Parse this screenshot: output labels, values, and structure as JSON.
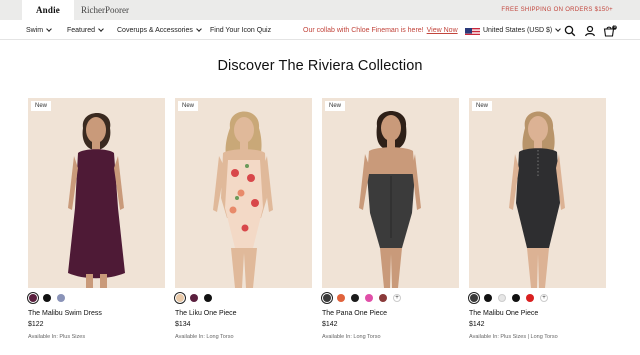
{
  "brands": [
    "Andie",
    "RicherPoorer"
  ],
  "promo": "FREE SHIPPING ON ORDERS $150+",
  "nav": {
    "items": [
      "Swim",
      "Featured",
      "Coverups & Accessories",
      "Find Your Icon Quiz"
    ],
    "collab_text": "Our collab with Chloe Fineman is here!",
    "collab_link": "View Now",
    "country": "United States (USD $)",
    "cart_count": "0"
  },
  "heading": "Discover The Riviera Collection",
  "products": [
    {
      "badge": "New",
      "name": "The Malibu Swim Dress",
      "price": "$122",
      "available": "Available In: Plus Sizes",
      "swatches": [
        "#5a1f3e",
        "#111111",
        "#8a93b8"
      ],
      "more_swatches": false
    },
    {
      "badge": "New",
      "name": "The Liku One Piece",
      "price": "$134",
      "available": "Available In: Long Torso",
      "swatches": [
        "#e9c9a8",
        "#5a1f3e",
        "#111111"
      ],
      "more_swatches": false
    },
    {
      "badge": "New",
      "name": "The Pana One Piece",
      "price": "$142",
      "available": "Available In: Long Torso",
      "swatches": [
        "#3a3a3a",
        "#e0633c",
        "#1b1b1b",
        "#e04fa8",
        "#8a3a3a"
      ],
      "more_swatches": true
    },
    {
      "badge": "New",
      "name": "The Malibu One Piece",
      "price": "$142",
      "available": "Available In: Plus Sizes | Long Torso",
      "swatches": [
        "#3a3a3a",
        "#111111",
        "#e6e6e6",
        "#111111",
        "#d92020"
      ],
      "more_swatches": true
    }
  ],
  "more_label": "+"
}
